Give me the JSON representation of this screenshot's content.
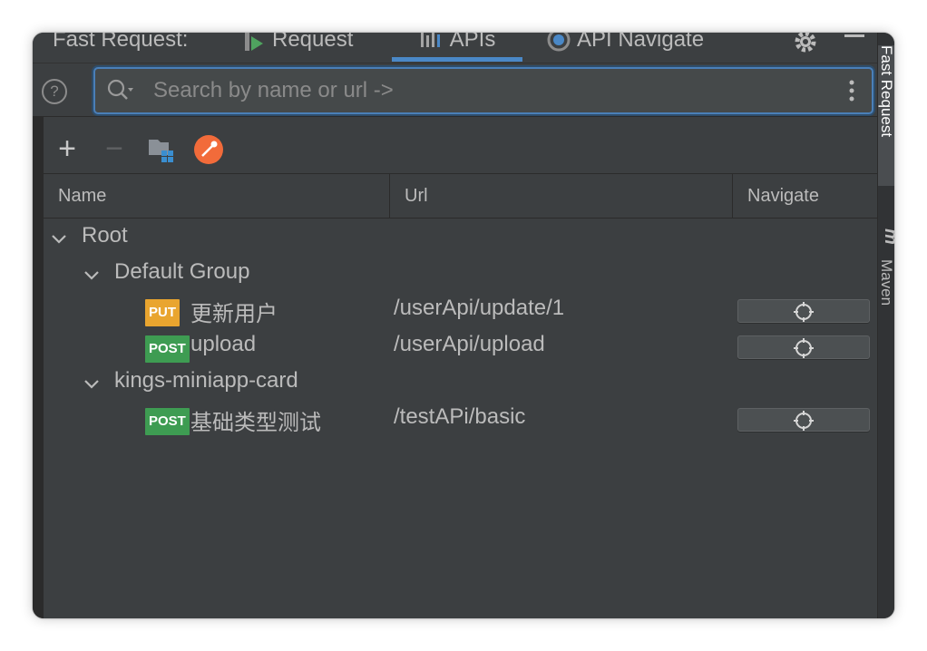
{
  "header": {
    "label": "Fast Request:",
    "tabs": [
      {
        "label": "Request",
        "icon": "request-run-icon"
      },
      {
        "label": "APIs",
        "icon": "apis-bars-icon",
        "active": true
      },
      {
        "label": "API Navigate",
        "icon": "navigate-target-icon"
      }
    ],
    "settings_icon": "gear-icon",
    "minimize_icon": "minimize-icon"
  },
  "search": {
    "placeholder": "Search by name or url ->",
    "value": ""
  },
  "toolbar": {
    "add_symbol": "+",
    "remove_symbol": "−",
    "icons": [
      "add-icon",
      "remove-icon",
      "module-folder-icon",
      "postman-icon"
    ]
  },
  "table": {
    "columns": [
      "Name",
      "Url",
      "Navigate"
    ]
  },
  "tree": {
    "root": "Root",
    "groups": [
      {
        "name": "Default Group",
        "apis": [
          {
            "method": "PUT",
            "name": "更新用户",
            "url": "/userApi/update/1"
          },
          {
            "method": "POST",
            "name": "upload",
            "url": "/userApi/upload"
          }
        ]
      },
      {
        "name": "kings-miniapp-card",
        "apis": [
          {
            "method": "POST",
            "name": "基础类型测试",
            "url": "/testAPi/basic"
          }
        ]
      }
    ]
  },
  "side_tabs": {
    "fast_request": "Fast Request",
    "maven": "Maven",
    "maven_logo": "m"
  },
  "colors": {
    "put": "#e9a52f",
    "post": "#3e9c52",
    "accent": "#4a88c7",
    "postman": "#f26b3a"
  }
}
